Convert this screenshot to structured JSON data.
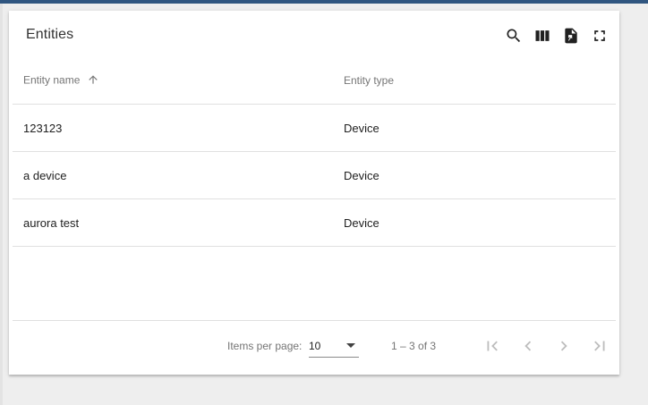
{
  "widget": {
    "title": "Entities",
    "toolbar": {
      "icons": [
        "search-icon",
        "columns-icon",
        "export-file-icon",
        "fullscreen-icon"
      ]
    }
  },
  "table": {
    "columns": [
      {
        "label": "Entity name",
        "sorted": "ascending"
      },
      {
        "label": "Entity type"
      }
    ],
    "rows": [
      {
        "name": "123123",
        "type": "Device"
      },
      {
        "name": "a device",
        "type": "Device"
      },
      {
        "name": "aurora test",
        "type": "Device"
      }
    ]
  },
  "pagination": {
    "items_per_page_label": "Items per page:",
    "items_per_page_value": "10",
    "range_label": "1 – 3 of 3",
    "buttons": [
      "first-page-icon",
      "previous-page-icon",
      "next-page-icon",
      "last-page-icon"
    ]
  },
  "colors": {
    "topbar": "#305680",
    "text": "#212121",
    "muted": "#757575",
    "disabled": "#bdbdbd"
  }
}
